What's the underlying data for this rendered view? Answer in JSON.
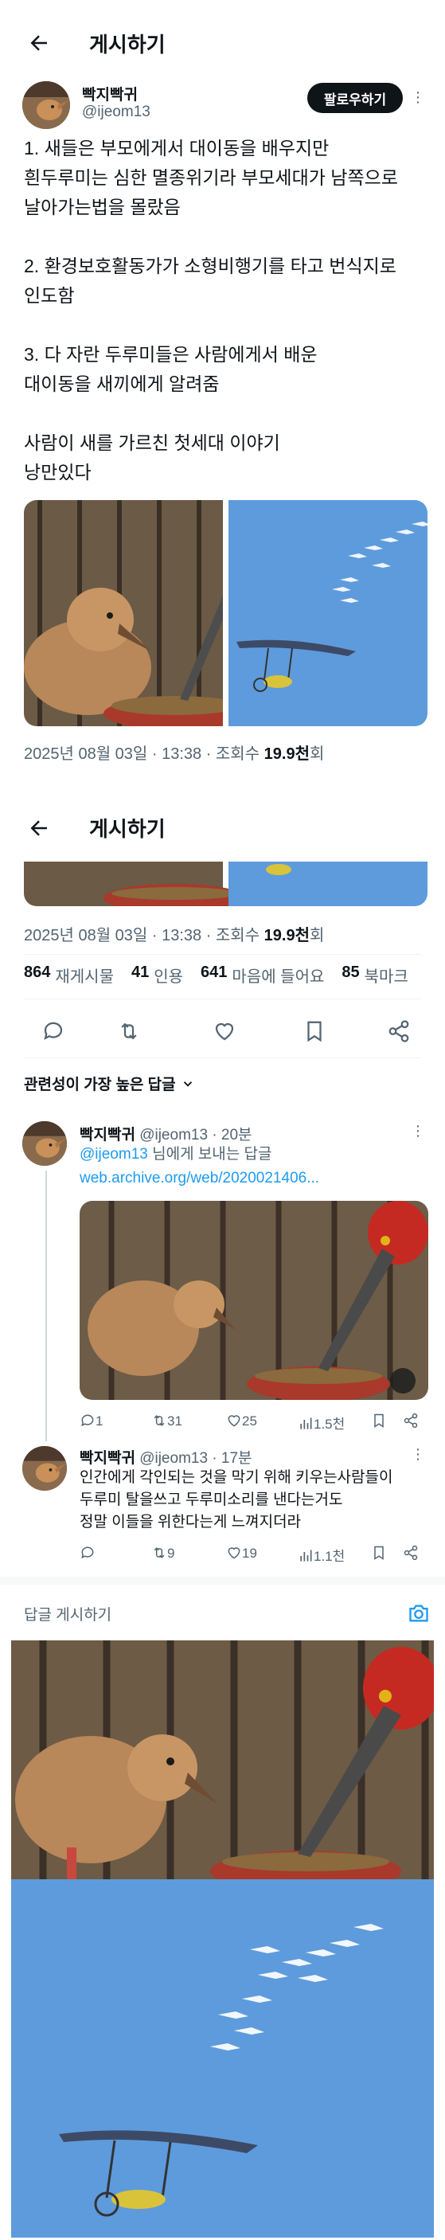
{
  "header": {
    "title": "게시하기",
    "back_icon": "arrow-left-icon"
  },
  "author": {
    "name": "빡지빡귀",
    "handle": "@ijeom13",
    "follow_label": "팔로우하기"
  },
  "tweet": {
    "lines": [
      "1. 새들은 부모에게서 대이동을 배우지만",
      "흰두루미는 심한 멸종위기라 부모세대가 남쪽으로",
      "날아가는법을 몰랐음",
      "",
      "2. 환경보호활동가가 소형비행기를 타고  번식지로",
      "인도함",
      "",
      "3. 다 자란 두루미들은 사람에게서 배운",
      "대이동을 새끼에게 알려줌",
      "",
      "사람이 새를 가르친 첫세대 이야기",
      "낭만있다"
    ]
  },
  "meta": {
    "date": "2025년 08월 03일 · 13:38 · 조회수 ",
    "views": "19.9천",
    "views_suffix": "회"
  },
  "stats": [
    {
      "n": "864",
      "label": "재게시물"
    },
    {
      "n": "41",
      "label": "인용"
    },
    {
      "n": "641",
      "label": "마음에 들어요"
    },
    {
      "n": "85",
      "label": "북마크"
    }
  ],
  "sort": {
    "label": "관련성이 가장 높은 답글"
  },
  "replies": [
    {
      "name": "빡지빡귀",
      "handle": "@ijeom13",
      "time": "· 20분",
      "mention": "@ijeom13",
      "mention_suffix": " 님에게 보내는 답글",
      "link": "web.archive.org/web/2020021406...",
      "counts": {
        "reply": "1",
        "repost": "31",
        "like": "25",
        "views": "1.5천"
      }
    },
    {
      "name": "빡지빡귀",
      "handle": "@ijeom13",
      "time": "· 17분",
      "lines": [
        "인간에게 각인되는 것을 막기 위해  키우는사람들이",
        "두루미 탈을쓰고 두루미소리를 낸다는거도",
        "정말 이들을 위한다는게 느껴지더라"
      ],
      "counts": {
        "reply": "",
        "repost": "9",
        "like": "19",
        "views": "1.1천"
      }
    }
  ],
  "reply_composer": {
    "label": "답글 게시하기"
  },
  "colors": {
    "accent": "#1d9bf0",
    "sky": "#5e9bdc",
    "text": "#0f1419",
    "muted": "#536471"
  }
}
